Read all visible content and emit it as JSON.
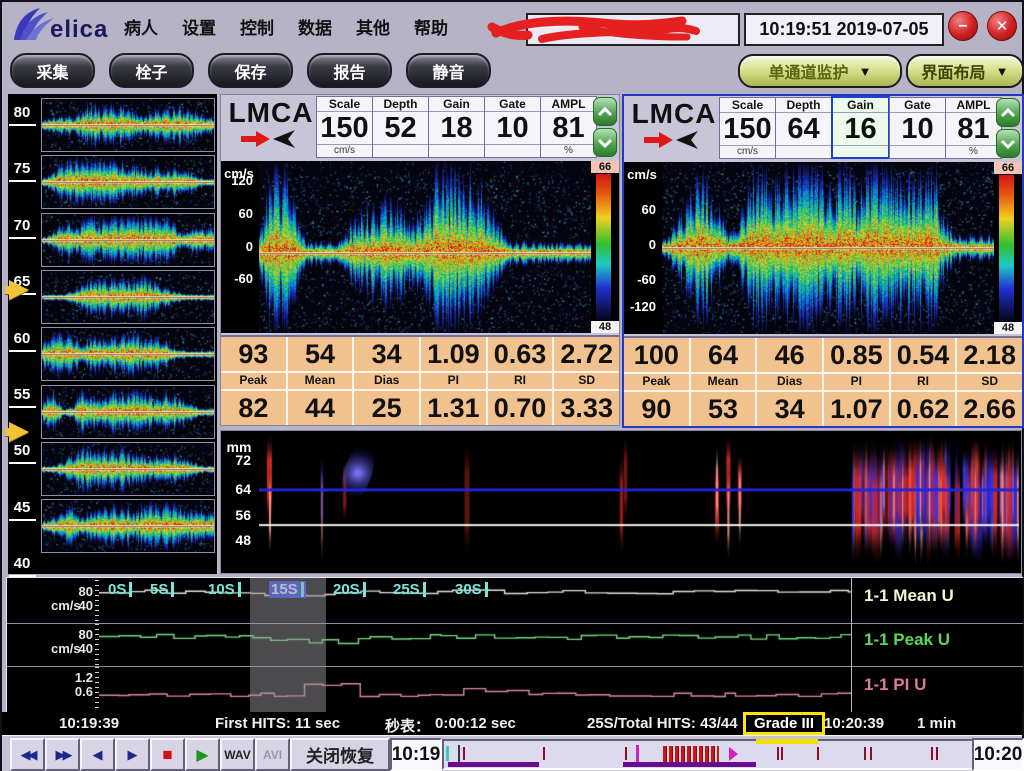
{
  "titlebar": {
    "logo": "elica",
    "menu": [
      "病人",
      "设置",
      "控制",
      "数据",
      "其他",
      "帮助"
    ],
    "clock": "10:19:51 2019-07-05",
    "minimize": "–",
    "close": "✕"
  },
  "toolbar": {
    "buttons": [
      "采集",
      "栓子",
      "保存",
      "报告",
      "静音"
    ],
    "monitor_dropdown": "单通道监护",
    "layout_dropdown": "界面布局",
    "caret": "▼"
  },
  "depth_scale": [
    "80",
    "75",
    "70",
    "65",
    "60",
    "55",
    "50",
    "45",
    "40"
  ],
  "channels": [
    {
      "name": "LMCA",
      "params": [
        {
          "label": "Scale",
          "value": "150",
          "unit": "cm/s"
        },
        {
          "label": "Depth",
          "value": "52",
          "unit": ""
        },
        {
          "label": "Gain",
          "value": "18",
          "unit": ""
        },
        {
          "label": "Gate",
          "value": "10",
          "unit": ""
        },
        {
          "label": "AMPL",
          "value": "81",
          "unit": "%"
        }
      ],
      "axis_unit": "cm/s",
      "axis_ticks": [
        "120",
        "60",
        "0",
        "-60"
      ],
      "colorbar": {
        "top": "66",
        "bottom": "48"
      },
      "results_headers": [
        "Peak",
        "Mean",
        "Dias",
        "PI",
        "RI",
        "SD"
      ],
      "results_top": [
        "93",
        "54",
        "34",
        "1.09",
        "0.63",
        "2.72"
      ],
      "results_bottom": [
        "82",
        "44",
        "25",
        "1.31",
        "0.70",
        "3.33"
      ]
    },
    {
      "name": "LMCA",
      "params": [
        {
          "label": "Scale",
          "value": "150",
          "unit": "cm/s"
        },
        {
          "label": "Depth",
          "value": "64",
          "unit": ""
        },
        {
          "label": "Gain",
          "value": "16",
          "unit": ""
        },
        {
          "label": "Gate",
          "value": "10",
          "unit": ""
        },
        {
          "label": "AMPL",
          "value": "81",
          "unit": "%"
        }
      ],
      "axis_unit": "cm/s",
      "axis_ticks": [
        "60",
        "0",
        "-60",
        "-120"
      ],
      "colorbar": {
        "top": "66",
        "bottom": "48"
      },
      "results_headers": [
        "Peak",
        "Mean",
        "Dias",
        "PI",
        "RI",
        "SD"
      ],
      "results_top": [
        "100",
        "64",
        "46",
        "0.85",
        "0.54",
        "2.18"
      ],
      "results_bottom": [
        "90",
        "53",
        "34",
        "1.07",
        "0.62",
        "2.66"
      ]
    }
  ],
  "mmode": {
    "unit": "mm",
    "ticks": [
      "72",
      "64",
      "56",
      "48"
    ]
  },
  "trend": {
    "time_labels": [
      "0S",
      "5S",
      "10S",
      "15S",
      "20S",
      "25S",
      "30S"
    ],
    "rows": [
      {
        "unit": "cm/s",
        "tick_hi": "80",
        "tick_lo": "40",
        "legend": "1-1 Mean U",
        "color": "#f5f5d0"
      },
      {
        "unit": "cm/s",
        "tick_hi": "80",
        "tick_lo": "40",
        "legend": "1-1 Peak U",
        "color": "#58d858"
      },
      {
        "unit": "",
        "tick_hi": "1.2",
        "tick_lo": "0.6",
        "legend": "1-1 PI U",
        "color": "#e07898"
      }
    ]
  },
  "status": {
    "start_time": "10:19:39",
    "first_hits": "First HITS: 11 sec",
    "stopwatch_label": "秒表：",
    "stopwatch_value": "0:00:12 sec",
    "hits_total": "25S/Total HITS: 43/44",
    "grade": "Grade III",
    "end_time": "10:20:39",
    "window_len": "1 min"
  },
  "player": {
    "icons": [
      "◀◀",
      "▶▶",
      "◀",
      "▶",
      "■",
      "▶",
      "↺"
    ],
    "wav": "WAV",
    "avi": "AVI",
    "close_restore": "关闭恢复",
    "time_left": "10:19",
    "time_right": "10:20"
  },
  "colors": {
    "selected_border": "#2838c0",
    "results_bg": "#f2c28e",
    "grade_box": "#ffe400",
    "timeline_marker": "#d020c0"
  }
}
